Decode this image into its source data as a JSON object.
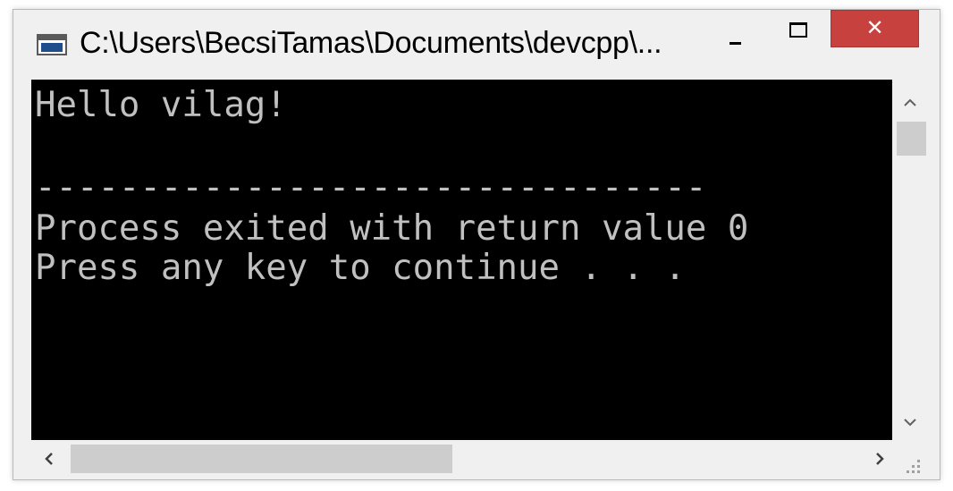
{
  "window": {
    "title": "C:\\Users\\BecsiTamas\\Documents\\devcpp\\...",
    "app_icon": "console-window-icon",
    "minimize_icon": "minimize-icon",
    "maximize_icon": "maximize-icon",
    "close_icon": "close-icon",
    "close_color": "#c7413f"
  },
  "console": {
    "background": "#000000",
    "text_color": "#c0c0c0",
    "lines": [
      "Hello vilag!",
      "--------------------------------",
      "Process exited with return value 0",
      "Press any key to continue . . ."
    ]
  },
  "scrollbars": {
    "vertical": {
      "up_glyph": "^",
      "down_glyph": "v"
    },
    "horizontal": {
      "left_glyph": "<",
      "right_glyph": ">"
    }
  }
}
